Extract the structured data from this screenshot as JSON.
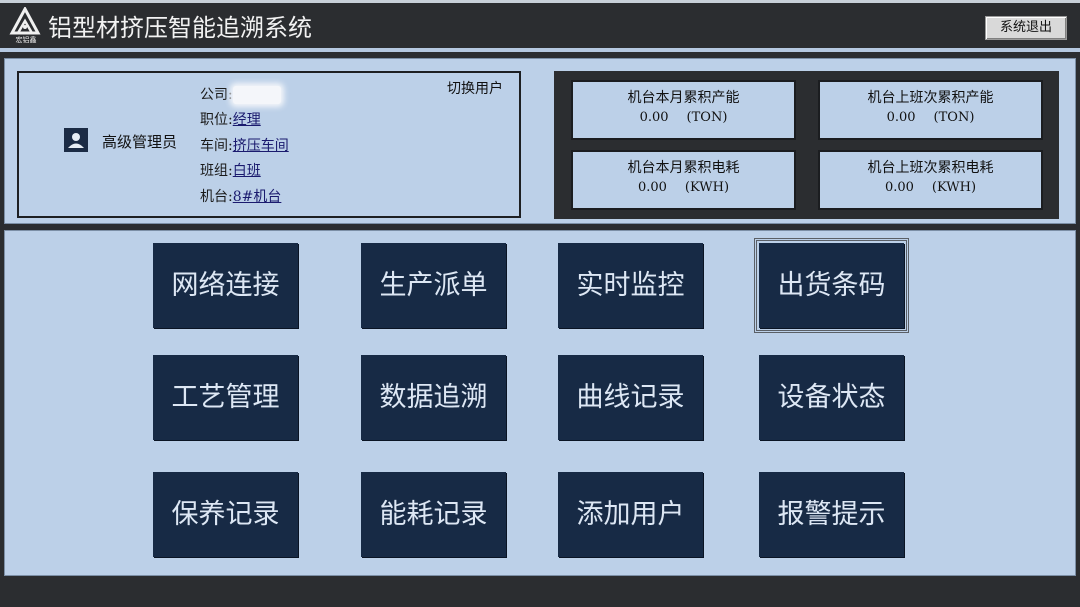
{
  "header": {
    "logo_text": "宏铝鑫",
    "title": "铝型材挤压智能追溯系统",
    "exit_label": "系统退出"
  },
  "user": {
    "role": "高级管理员",
    "switch_label": "切换用户",
    "fields": [
      {
        "label": "公司:",
        "value": ""
      },
      {
        "label": "职位:",
        "value": "经理"
      },
      {
        "label": "车间:",
        "value": "挤压车间"
      },
      {
        "label": "班组:",
        "value": "白班"
      },
      {
        "label": "机台:",
        "value": "8#机台"
      }
    ]
  },
  "stats": [
    {
      "label": "机台本月累积产能",
      "value": "0.00",
      "unit": "(TON)"
    },
    {
      "label": "机台上班次累积产能",
      "value": "0.00",
      "unit": "(TON)"
    },
    {
      "label": "机台本月累积电耗",
      "value": "0.00",
      "unit": "(KWH)"
    },
    {
      "label": "机台上班次累积电耗",
      "value": "0.00",
      "unit": "(KWH)"
    }
  ],
  "menu": [
    [
      "网络连接",
      "生产派单",
      "实时监控",
      "出货条码"
    ],
    [
      "工艺管理",
      "数据追溯",
      "曲线记录",
      "设备状态"
    ],
    [
      "保养记录",
      "能耗记录",
      "添加用户",
      "报警提示"
    ]
  ],
  "colors": {
    "panel": "#bcd0e8",
    "button": "#172a45",
    "frame": "#2b2d30"
  }
}
